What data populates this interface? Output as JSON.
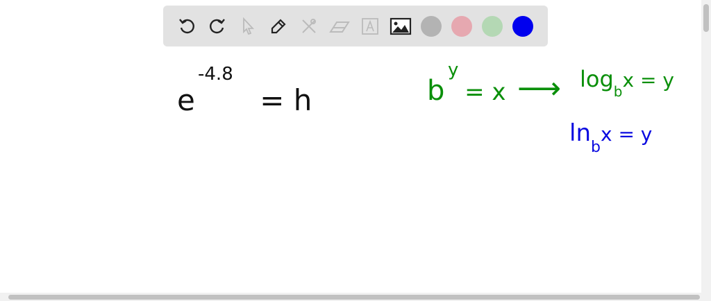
{
  "toolbar": {
    "tools": [
      "undo-icon",
      "redo-icon",
      "select-icon",
      "pen-icon",
      "tools-icon",
      "eraser-icon",
      "text-icon",
      "image-icon"
    ],
    "colors": [
      "#b3b3b3",
      "#e6a8b0",
      "#b4d8b4",
      "#0000ee"
    ]
  },
  "canvas": {
    "eq1": {
      "base": "e",
      "exp": "-4.8",
      "rest": "= h"
    },
    "eq2": {
      "base": "b",
      "exp": "y",
      "rest": "= x"
    },
    "arrow": "⟶",
    "eq3": {
      "pre": "log",
      "sub": "b",
      "rest": "x = y"
    },
    "eq4": {
      "pre": "ln",
      "sub": "b",
      "rest": "x = y"
    }
  }
}
